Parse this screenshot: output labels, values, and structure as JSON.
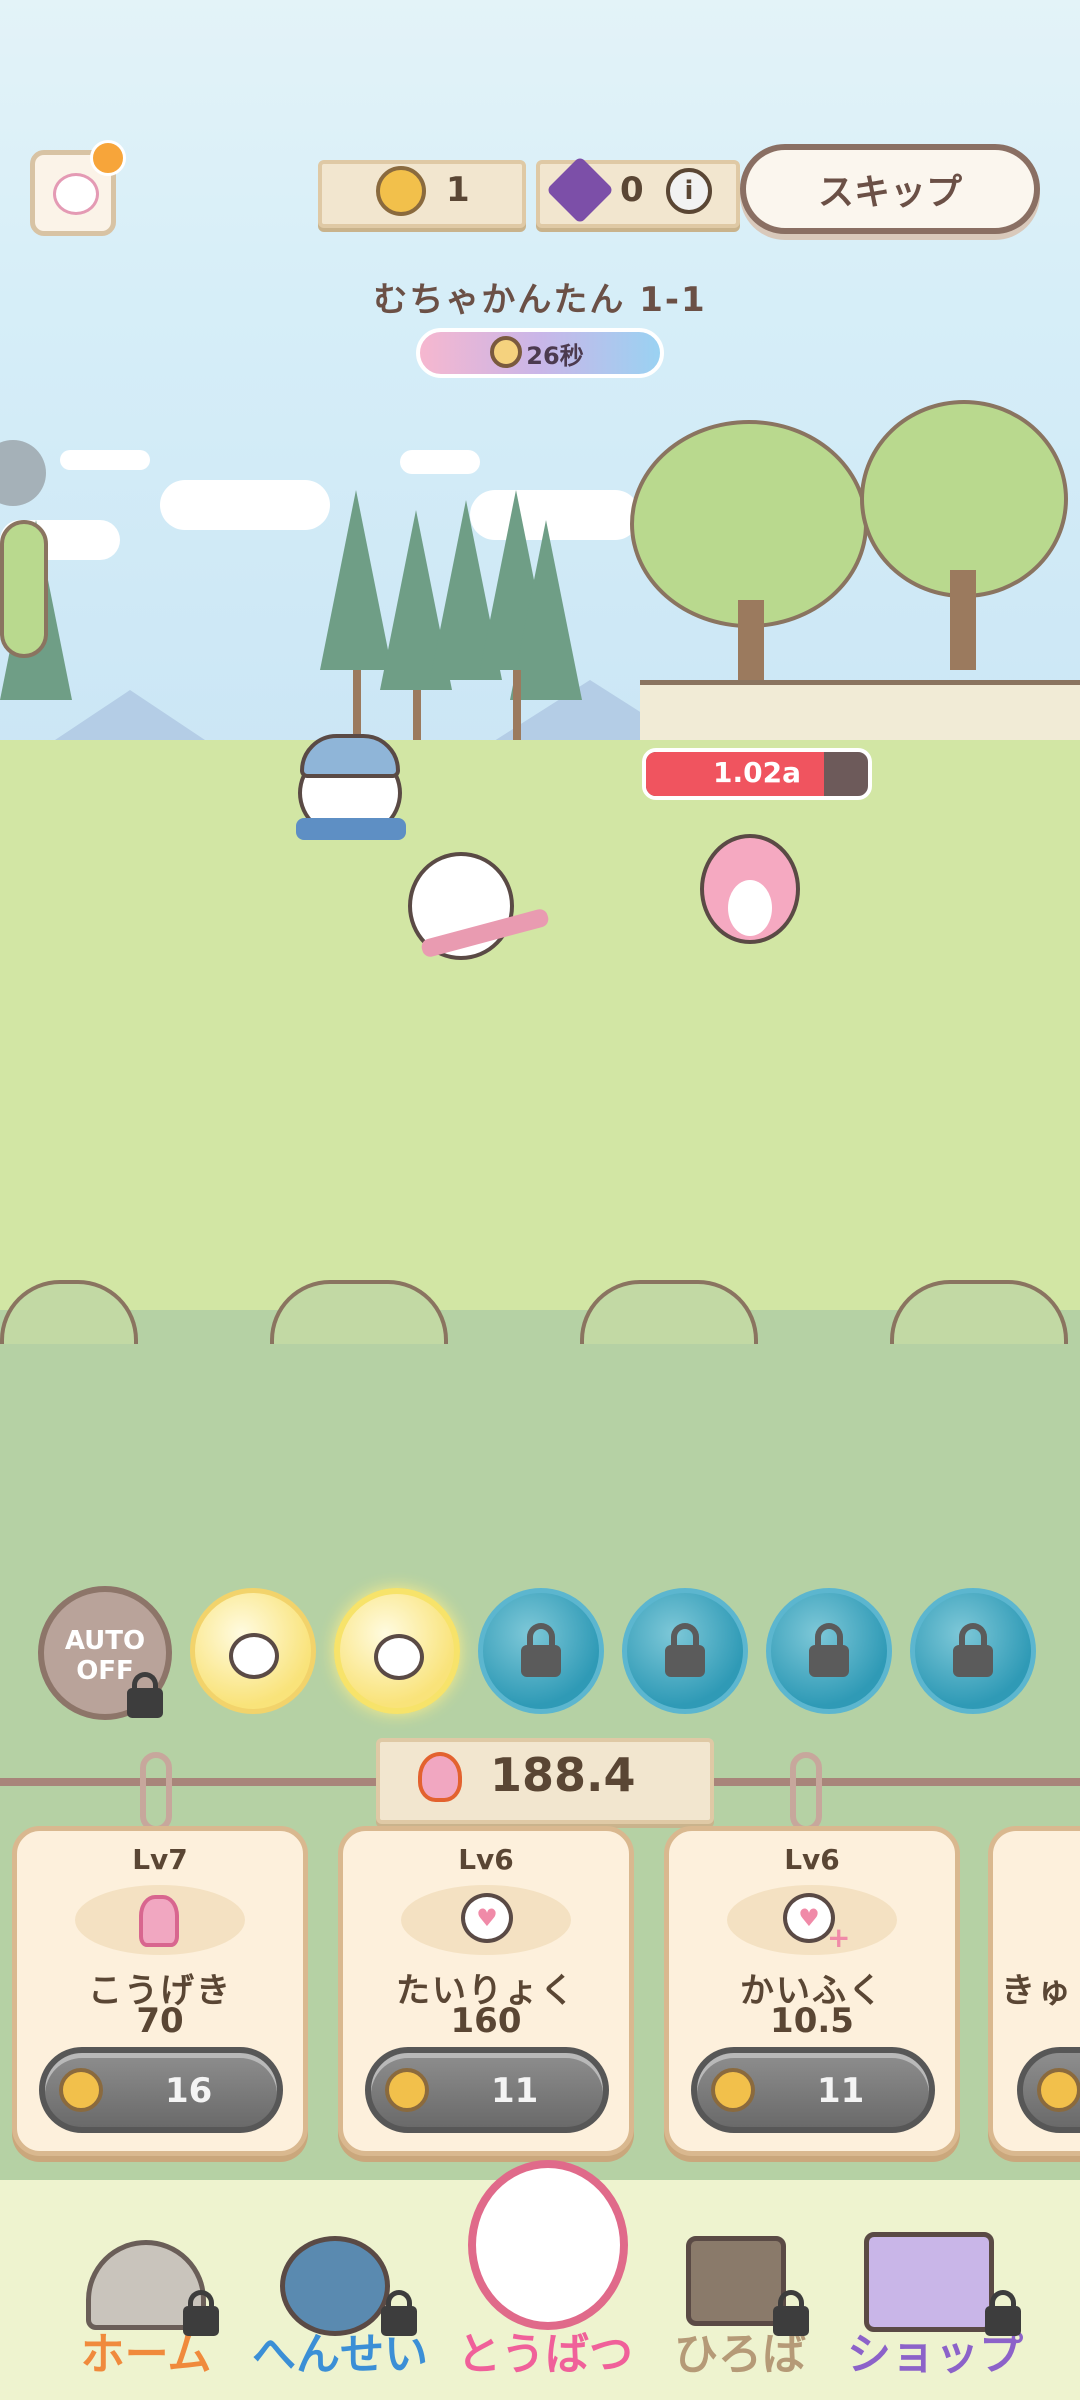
{
  "header": {
    "coin_count": "1",
    "gem_count": "0",
    "skip_label": "スキップ",
    "stage_title": "むちゃかんたん 1-1",
    "timer": "26秒"
  },
  "battle": {
    "enemy_hp_text": "1.02a",
    "enemy_hp_fraction": 0.8
  },
  "skills": {
    "auto_label_line1": "AUTO",
    "auto_label_line2": "OFF"
  },
  "power": {
    "value": "188.4"
  },
  "upgrades": [
    {
      "level": "Lv7",
      "name": "こうげき",
      "value": "70",
      "cost": "16",
      "icon": "slingshot-icon"
    },
    {
      "level": "Lv6",
      "name": "たいりょく",
      "value": "160",
      "cost": "11",
      "icon": "heart-icon"
    },
    {
      "level": "Lv6",
      "name": "かいふく",
      "value": "10.5",
      "cost": "11",
      "icon": "heal-icon"
    },
    {
      "level": "",
      "name": "きゅ",
      "value": "",
      "cost": "",
      "icon": "partial-card"
    }
  ],
  "nav": [
    {
      "label": "ホーム",
      "color": "#f08a3c",
      "locked": true
    },
    {
      "label": "へんせい",
      "color": "#3b8fd6",
      "locked": true
    },
    {
      "label": "とうばつ",
      "color": "#f0609a",
      "locked": false
    },
    {
      "label": "ひろば",
      "color": "#b59a77",
      "locked": true
    },
    {
      "label": "ショップ",
      "color": "#8c62c9",
      "locked": true
    }
  ],
  "colors": {
    "hp_bar": "#f0545f",
    "locked_skill": "#2f9ab6",
    "active_skill": "#f9e37a"
  }
}
